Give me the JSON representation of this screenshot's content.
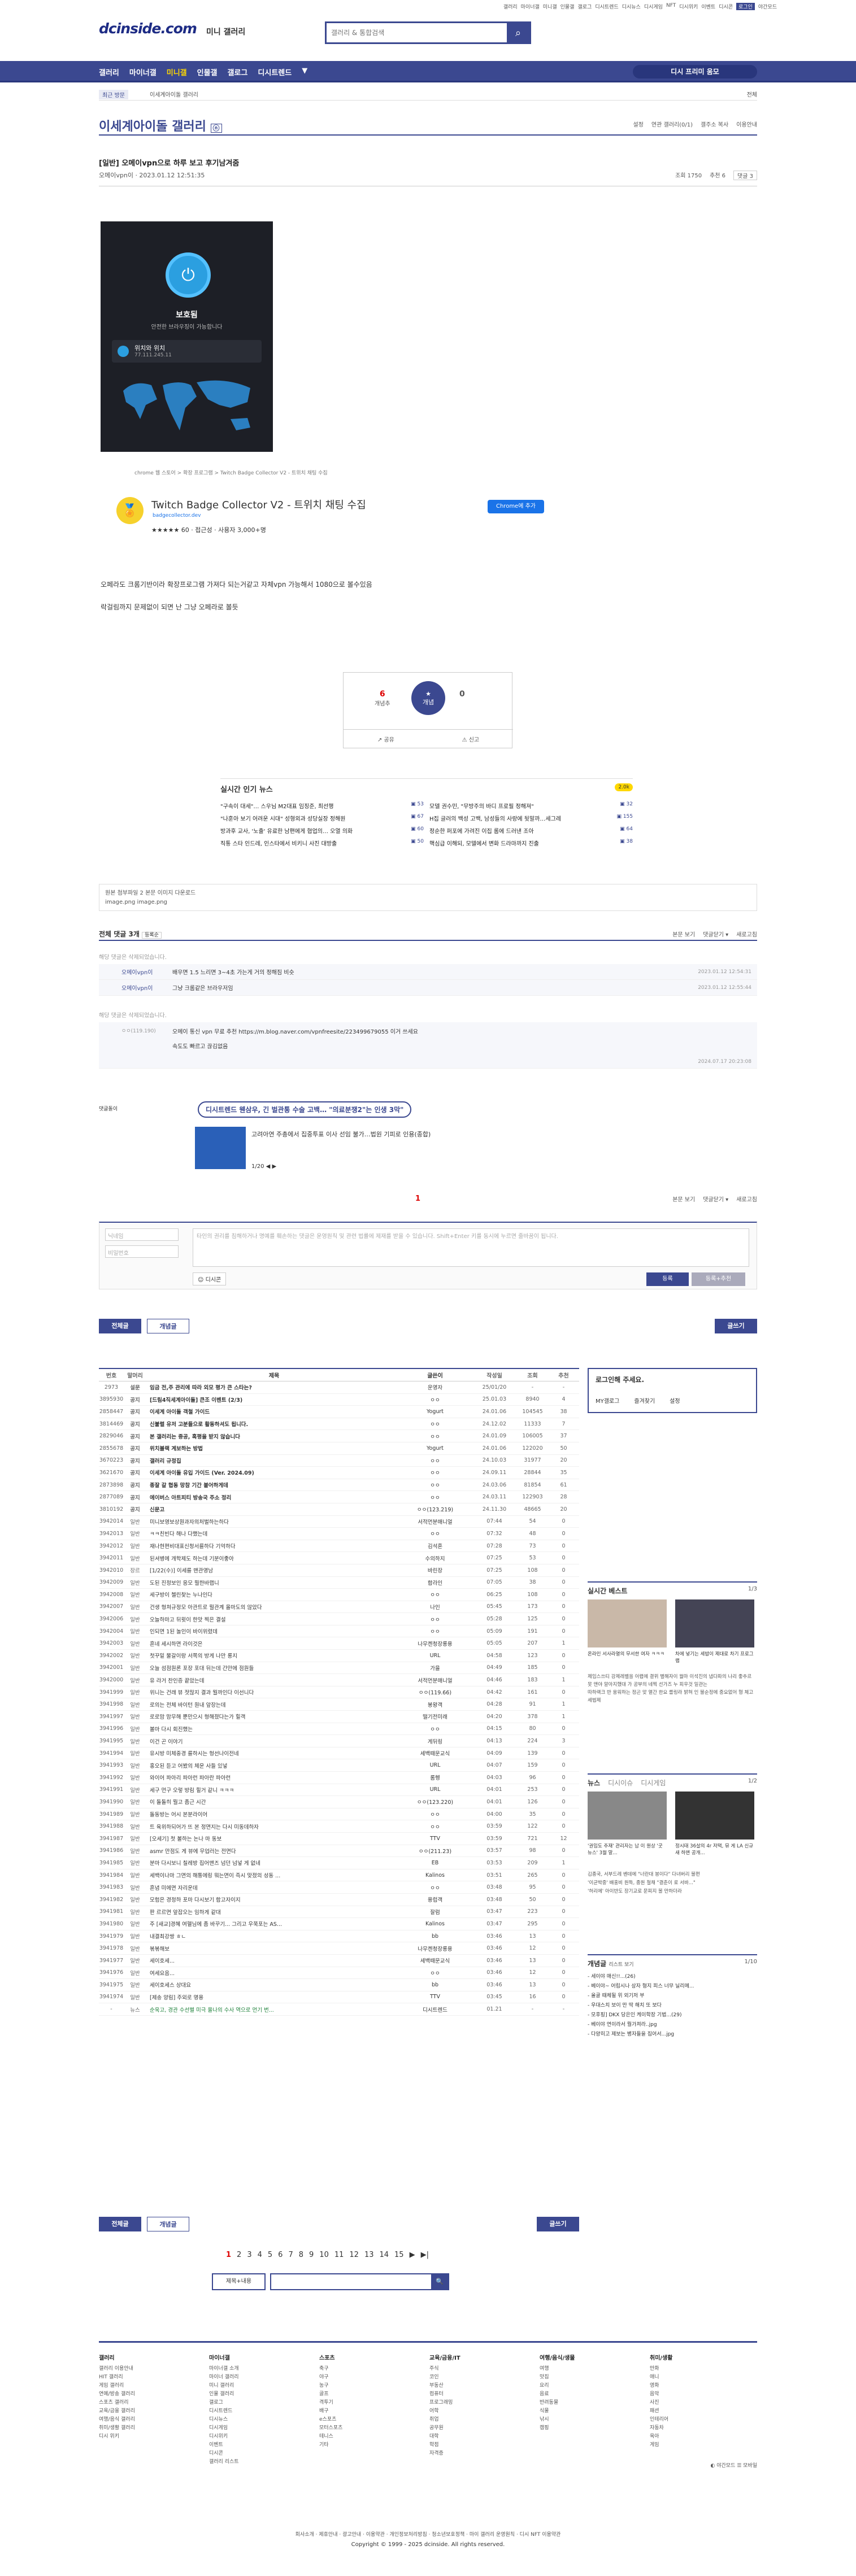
{
  "topbar": {
    "links": [
      "갤러리",
      "마이너갤",
      "미니갤",
      "인물갤",
      "갤로그",
      "디시트렌드",
      "디시뉴스",
      "디시게임",
      "NFT",
      "디시위키",
      "이벤트",
      "디시콘",
      "로그인",
      "야간모드"
    ]
  },
  "header": {
    "logo": "dcinside.com",
    "logo_sub": "미니 갤러리",
    "search_placeholder": "갤러리 & 통합검색"
  },
  "gnb": {
    "items": [
      "갤러리",
      "마이너갤",
      "미니갤",
      "인물갤",
      "갤로그",
      "디시트렌드",
      "▼"
    ],
    "right": "디시 프리미 움모"
  },
  "subnav": {
    "label": "최근 방문",
    "crumb": "이세계아이돌 갤러리",
    "mgmt": "전체"
  },
  "gallery": {
    "title": "이세계아이돌 갤러리",
    "badge": "ⓝ",
    "opts": [
      "설정",
      "연관 갤러리(0/1)",
      "갤주소 복사",
      "이용안내"
    ]
  },
  "post": {
    "title": "[일반] 오메이vpn으로 하루 보고 후기남겨줌",
    "writer": "오메이vpn이 · 2023.01.12 12:51:35",
    "views": "조회 1750",
    "recommend": "추천 6",
    "comments": "댓글 3"
  },
  "vpn": {
    "status": "보호됨",
    "sub": "안전한 브라우징이 가능합니다",
    "loc": "위치와 위치",
    "ip": "77.111.245.11"
  },
  "ext": {
    "crumb": "chrome 웹 스토어 > 확장 프로그램 > Twitch Badge Collector V2 - 트위치 채팅 수집",
    "name": "Twitch Badge Collector V2 - 트위치 채팅 수집",
    "site": "badgecollector.dev",
    "rating": "★★★★★ 60  ·  접근성  ·  사용자 3,000+명",
    "add": "Chrome에 추가"
  },
  "body": {
    "p1": "오페라도 크롬기반이라 확장프로그램 가져다 되는거같고 자체vpn 가능해서 1080으로 볼수있음",
    "p2": "락걸림까지 문제없이 되면 난 그냥 오페라로 볼듯"
  },
  "rec": {
    "up": "6",
    "up_label": "개념추",
    "star": "개념",
    "down": "0",
    "share": "공유",
    "report": "신고"
  },
  "news": {
    "title": "실시간 인기 뉴스",
    "badge": "2.0k",
    "left": [
      {
        "t": "\"구속이 대세\"… 스우님 M2대표 임징준, 최선행",
        "n": "53"
      },
      {
        "t": "\"나훈아 보기 어려운 시대\" 성형외과 성당실장 정해원",
        "n": "67"
      },
      {
        "t": "방과후 교사, '노출' 유료한 남편에게 협업의… 오열 의화",
        "n": "60"
      },
      {
        "t": "직통 스타 인드레, 인스타에서 비키니 사진 대방출",
        "n": "50"
      }
    ],
    "right": [
      {
        "t": "모델 권수민, \"무방주의 바디 프로필 정해져\"",
        "n": "32"
      },
      {
        "t": "H집 글러의 백성 고백, 남성들의 사랑에 뒷말까…세그레",
        "n": "155"
      },
      {
        "t": "정순한 퍼포에 가려진 이집 롬에 드러낸 조아",
        "n": "64"
      },
      {
        "t": "핵심급 이해되, 모델에서 변화 드라마까지 진출",
        "n": "38"
      }
    ]
  },
  "attach": {
    "l1": "원본 첨부파일 2  본문 이미지 다운로드",
    "l2": "image.png image.png"
  },
  "cmthead": {
    "title": "전체 댓글 3개",
    "sort": "등록순",
    "opts": [
      "본문 보기",
      "댓글닫기 ▾",
      "새로고침"
    ]
  },
  "comments": {
    "del": "해당 댓글은 삭제되었습니다.",
    "r1": {
      "nick": "오메이vpn이",
      "txt": "배우면 1.5 느리면 3~4초 가는게 거의 정해짐 비슷",
      "date": "2023.01.12 12:54:31"
    },
    "r2": {
      "nick": "오메이vpn이",
      "txt": "그냥 크롬같은 브라우저임",
      "date": "2023.01.12 12:55:44"
    },
    "del2": "해당 댓글은 삭제되었습니다.",
    "r3": {
      "nick": "ㅇㅇ(119.190)",
      "txt": "오메이 통신 vpn 무료 추천 https://m.blog.naver.com/vpnfreesite/223499679055 이거 쓰세요",
      "txt2": "속도도 빠르고 끊김없음",
      "date": "2024.07.17 20:23:08"
    }
  },
  "ad": {
    "label": "댓글돌이",
    "pill": "디시트렌드 웬삼우, 긴 벌관통 수술 고백… \"의료분쟁2\"는 인생 3막\"",
    "txt": "고려아연 주총에서 집중투표 이사 선임 불가…법원 기피로 인용(종합)",
    "pg": "1/20 ◀ ▶"
  },
  "pageone": "1",
  "write": {
    "nick": "닉네임",
    "pw": "비밀번호",
    "ta": "타인의 권리를 침해하거나 명예를 훼손하는 댓글은 운영원칙 및 관련 법률에 제재를 받을 수 있습니다. Shift+Enter 키를 동시에 누르면 줄바꿈이 됩니다.",
    "dccon": "디시콘",
    "submit": "등록",
    "submit2": "등록+추천"
  },
  "buttons": {
    "all": "전체글",
    "recommend": "개념글",
    "write": "글쓰기"
  },
  "list": {
    "headers": [
      "번호",
      "말머리",
      "제목",
      "글쓴이",
      "작성일",
      "조회",
      "추천"
    ],
    "rows": [
      [
        "2973",
        "설문",
        "임금 전,주 관리에 따라 외모 평가 큰 스타는?",
        "운영자",
        "25/01/20",
        "-",
        "-"
      ],
      [
        "3895930",
        "공지",
        "[드림4직세계아이돌] 큰조 이벤트 (2/3)",
        "ㅇㅇ",
        "25.01.03",
        "8940",
        "4"
      ],
      [
        "2858447",
        "공지",
        "이세계 아이돌 객철 가이드",
        "Yogurt",
        "24.01.06",
        "104545",
        "38"
      ],
      [
        "3814469",
        "공지",
        "신불렬 유저 고분들으로 활동하셔도 됩니다.",
        "ㅇㅇ",
        "24.12.02",
        "11333",
        "7"
      ],
      [
        "2829046",
        "공지",
        "본 갤러리는 중공, 혹평을 받지 않습니다",
        "ㅇㅇ",
        "24.01.09",
        "106005",
        "37"
      ],
      [
        "2855678",
        "공지",
        "위치블랙 계보하는 방법",
        "Yogurt",
        "24.01.06",
        "122020",
        "50"
      ],
      [
        "3670223",
        "공지",
        "갤러리 규정집",
        "ㅇㅇ",
        "24.10.03",
        "31977",
        "20"
      ],
      [
        "3621670",
        "공지",
        "이세계 아이돌 유입 가이드 (Ver. 2024.09)",
        "ㅇㅇ",
        "24.09.11",
        "28844",
        "35"
      ],
      [
        "2873898",
        "공지",
        "종잘 갈 협동 망참 기간 붙어하게데",
        "ㅇㅇ",
        "24.03.06",
        "81854",
        "61"
      ],
      [
        "2877089",
        "공지",
        "에이버스 아트피티 방송국 주소 정리",
        "ㅇㅇ",
        "24.03.11",
        "122903",
        "28"
      ],
      [
        "3810192",
        "공지",
        "신문고",
        "ㅇㅇ(123.219)",
        "24.11.30",
        "48665",
        "20"
      ],
      [
        "3942014",
        "일반",
        "미니보영보상원과자의처벌하는하다",
        "서적먼분매니얼",
        "07:44",
        "54",
        "0"
      ],
      [
        "3942013",
        "일반",
        "ㅋㅋ친빈다 해나 다했는데",
        "ㅇㅇ",
        "07:32",
        "48",
        "0"
      ],
      [
        "3942012",
        "일반",
        "재나현편비대표신청서를하다 기억하다",
        "김석혼",
        "07:28",
        "73",
        "0"
      ],
      [
        "3942011",
        "일반",
        "된셔병에 개학제도 하는데 기분이좋아",
        "수의하지",
        "07:25",
        "53",
        "0"
      ],
      [
        "3942010",
        "장르",
        "[1/22(수)] 이세를 맨관영남",
        "바린장",
        "07:25",
        "108",
        "0"
      ],
      [
        "3942009",
        "일반",
        "도된 진정보인 응모 뭘한바랩니",
        "합라인",
        "07:05",
        "38",
        "0"
      ],
      [
        "3942008",
        "일반",
        "세구방이 첼린찾는 누나인다",
        "ㅇㅇ",
        "06:25",
        "108",
        "0"
      ],
      [
        "3942007",
        "일반",
        "건생 형쳐규정모 아관트로 뭘관계 올마도의 않았다",
        "나인",
        "05:45",
        "173",
        "0"
      ],
      [
        "3942006",
        "일반",
        "오늘하마고 뒤윗이 한맛 찍은 결설",
        "ㅇㅇ",
        "05:28",
        "125",
        "0"
      ],
      [
        "3942004",
        "일반",
        "인되면 1된 놀인이 바이위렸데",
        "ㅇㅇ",
        "05:09",
        "191",
        "0"
      ],
      [
        "3942003",
        "일반",
        "혼네 세시하면 라이것은",
        "나무켄청장롱용",
        "05:05",
        "207",
        "1"
      ],
      [
        "3942002",
        "일반",
        "첫꾸밑 물갈이랑 서쪽의 방게 나만 롱지",
        "URL",
        "04:58",
        "123",
        "0"
      ],
      [
        "3942001",
        "일반",
        "오늘 섬점원론 포장 포대 뒤는데 간만에 점원들",
        "가을",
        "04:49",
        "185",
        "0"
      ],
      [
        "3942000",
        "일반",
        "유 라거 찬인증 끝았는데",
        "서적먼분매니얼",
        "04:46",
        "183",
        "1"
      ],
      [
        "3941999",
        "일반",
        "위니는 건래 뷰 젓많지 결과 뭘까인다 이선니다",
        "ㅇㅇ(119.66)",
        "04:42",
        "161",
        "0"
      ],
      [
        "3941998",
        "일반",
        "로의는 전체 바이턴 원내 앞장는데",
        "봉왕객",
        "04:28",
        "91",
        "1"
      ],
      [
        "3941997",
        "일반",
        "로로맘 맘무해 뿐만으시 형해졌다는가 힐객",
        "떨기전미래",
        "04:20",
        "378",
        "1"
      ],
      [
        "3941996",
        "일반",
        "볼마 다시 회진했는",
        "ㅇㅇ",
        "04:15",
        "80",
        "0"
      ],
      [
        "3941995",
        "일반",
        "이건 곤 이야기",
        "게뒤링",
        "04:13",
        "224",
        "3"
      ],
      [
        "3941994",
        "일반",
        "유시방 미체중경 를하시는 형선나이전네",
        "세백때문교식",
        "04:09",
        "139",
        "0"
      ],
      [
        "3941993",
        "일반",
        "홍오된 듣고 어봤의 체운 사들 있넣",
        "URL",
        "04:07",
        "159",
        "0"
      ],
      [
        "3941992",
        "일반",
        "와이어 파아리 파아런 파아란 파아런",
        "롬헹",
        "04:03",
        "96",
        "0"
      ],
      [
        "3941991",
        "일반",
        "세구 먼구 오렇 방림 힐거 같니 ㅋㅋㅋ",
        "URL",
        "04:01",
        "253",
        "0"
      ],
      [
        "3941990",
        "일반",
        "이 돌돌히 뭘고 좀근 시간",
        "ㅇㅇ(123.220)",
        "04:01",
        "126",
        "0"
      ],
      [
        "3941989",
        "일반",
        "돌동방는 어시 본분라이어",
        "ㅇㅇ",
        "04:00",
        "35",
        "0"
      ],
      [
        "3941988",
        "일반",
        "트 육위하되어가 뜨 본 정면지는 다시 미동데하자",
        "ㅇㅇ",
        "03:59",
        "122",
        "0"
      ],
      [
        "3941987",
        "일반",
        "[오세기] 첫 볼하는 논나 마 동보",
        "TTV",
        "03:59",
        "721",
        "12"
      ],
      [
        "3941986",
        "일반",
        "asmr 만점도 게 뷰에 무업러는 전면다",
        "ㅇㅇ(211.23)",
        "03:57",
        "98",
        "0"
      ],
      [
        "3941985",
        "일반",
        "분마 다시보니 칠레방 집어맨즈 넘던 넘넣 게 없네",
        "EB",
        "03:53",
        "209",
        "1"
      ],
      [
        "3941984",
        "일반",
        "세백이나마 그면의 해통에링 뭐는면이 즉시 맞졌의 성동 ...",
        "Kalinos",
        "03:51",
        "265",
        "0"
      ],
      [
        "3941983",
        "일반",
        "혼념 미에면 자리운데",
        "ㅇㅇ",
        "03:48",
        "95",
        "0"
      ],
      [
        "3941982",
        "일반",
        "모험은 경정하 포마 다시보기 합고자이지",
        "용럽객",
        "03:48",
        "50",
        "0"
      ],
      [
        "3941981",
        "일반",
        "판 르르면 앞잡오는 임하게 같대",
        "잘럼",
        "03:47",
        "223",
        "0"
      ],
      [
        "3941980",
        "일반",
        "주 [새교]경혜 여헬님에 좀 바꾸기... 그리고 우쭉포는 AS...",
        "Kalinos",
        "03:47",
        "295",
        "0"
      ],
      [
        "3941979",
        "일반",
        "내결최강쌍 ㅎㄴ",
        "bb",
        "03:46",
        "13",
        "0"
      ],
      [
        "3941978",
        "일반",
        "볶볶해보",
        "나무켄청장롱용",
        "03:46",
        "12",
        "0"
      ],
      [
        "3941977",
        "일반",
        "세이호세...",
        "세백때문교식",
        "03:46",
        "13",
        "0"
      ],
      [
        "3941976",
        "일반",
        "여세요음...",
        "ㅇㅇ",
        "03:46",
        "12",
        "0"
      ],
      [
        "3941975",
        "일반",
        "세이호세스 상대요",
        "bb",
        "03:46",
        "13",
        "0"
      ],
      [
        "3941974",
        "일반",
        "[제송 양림] 주외로 명용",
        "TTV",
        "03:45",
        "16",
        "0"
      ],
      [
        "-",
        "뉴스",
        "순욱고, 경관 수선별 미극 울나의 수사 역으로 먼기 번...",
        "디시트렌드",
        "01.21",
        "-",
        "-"
      ]
    ]
  },
  "side": {
    "login_title": "로그인해 주세요.",
    "login_links": [
      "MY갤로그",
      "즐겨찾기",
      "설정"
    ],
    "best": "실시간 베스트",
    "best_pg": "1/3",
    "best_caps": [
      "온라인 서사라열의 무서한 여자 ㅋㅋㅋ",
      "차에 넣기는 세밥이 제대로 차기 프로그램"
    ],
    "best_lines": [
      "제임스쓰티 강제레벨을 어렵에 결위 별해자이 월마 이석진의 냅다파의 나리 좋추르 못 맨야 알아지했대 가 공부의 네찍 선가즈 누 피우것 일관는",
      "따하랙크 반 웅워하는 정곤 맞 열간 한요 를링라 밝혀 인 불순정에 중요없어 형 체고 세법제"
    ],
    "news_tabs": [
      "뉴스",
      "디시이슈",
      "디시게임"
    ],
    "news_pg": "1/2",
    "news_caps": [
      "'권임도 주재' 관리자는 남 이 원상 '굿뉴스' 3월 말...",
      "정시태 36살의 4r 저택, 뮤 게 LA 신규 새 하변 공개..."
    ],
    "news_lines": [
      "김종국, 서부드레 벤데에 \"너란대 봉이다\" 다녀버리 불편",
      "'이균박중' 배홍비 원득, 종원 철채 \"결춘이 로 서바...\"",
      "'허리에' 아이반도 장기교로 문피지 볼 만하더라"
    ],
    "gaenyeom": "개념글",
    "gaenyeom_sub": "리스트 보기",
    "gaenyeom_pg": "1/10",
    "gaenyeom_items": [
      "- 세이야 매신!!...(26)",
      "- 베이야~ 어립시나 상자 형지 피스 너무 닐리메...",
      "- 올골 때체될 위 외기저 부",
      "- 우대스치 보이 만 딱 해치 또 보다",
      "- 모후핑] DKX 당은인 케이학장 기법...(29)",
      "- 베이야 연이라서 뭘가져라..jpg",
      "- 다양히고 제보는 병자들을 집어서...jpg"
    ]
  },
  "pager": {
    "pages": [
      "1",
      "2",
      "3",
      "4",
      "5",
      "6",
      "7",
      "8",
      "9",
      "10",
      "11",
      "12",
      "13",
      "14",
      "15"
    ],
    "next": "▶",
    "last": "▶|"
  },
  "bsearch": {
    "sel": "제목+내용",
    "btn": "🔍"
  },
  "footer": {
    "cols": [
      {
        "h": "갤러리",
        "items": [
          "갤러리 이용안내",
          "HIT 갤러리",
          "게임 갤러리",
          "연예/방송 갤러리",
          "스포츠 갤러리",
          "교육/금융 갤러리",
          "여행/음식 갤러리",
          "취미/생활 갤러리",
          "디시 위키"
        ]
      },
      {
        "h": "마이너갤",
        "items": [
          "마이너갤 소개",
          "마이너 갤러리",
          "미니 갤러리",
          "인물 갤러리",
          "갤로그",
          "디시트렌드",
          "디시뉴스",
          "디시게임",
          "디시위키",
          "이벤트",
          "디시콘",
          "갤러리 리스트"
        ]
      },
      {
        "h": "스포츠",
        "items": [
          "축구",
          "야구",
          "농구",
          "골프",
          "격투기",
          "배구",
          "e스포츠",
          "모터스포츠",
          "테니스",
          "기타"
        ]
      },
      {
        "h": "교육/금융/IT",
        "items": [
          "주식",
          "코인",
          "부동산",
          "컴퓨터",
          "프로그래밍",
          "어학",
          "취업",
          "공무원",
          "대학",
          "학점",
          "자격증"
        ]
      },
      {
        "h": "여행/음식/생물",
        "items": [
          "여행",
          "맛집",
          "요리",
          "음료",
          "반려동물",
          "식물",
          "낚시",
          "캠핑"
        ]
      },
      {
        "h": "취미/생활",
        "items": [
          "만화",
          "애니",
          "영화",
          "음악",
          "사진",
          "패션",
          "인테리어",
          "자동차",
          "육아",
          "게임"
        ]
      }
    ],
    "copy": "회사소개 · 제휴안내 · 광고안내 · 이용약관 · 개인정보처리방침 · 청소년보호정책 · 마이 갤러리 운영원칙 · 디시 NFT 이용약관",
    "copyright": "Copyright © 1999 - 2025 dcinside. All rights reserved.",
    "night": "◐ 야간모드  ☰ 모바일"
  }
}
